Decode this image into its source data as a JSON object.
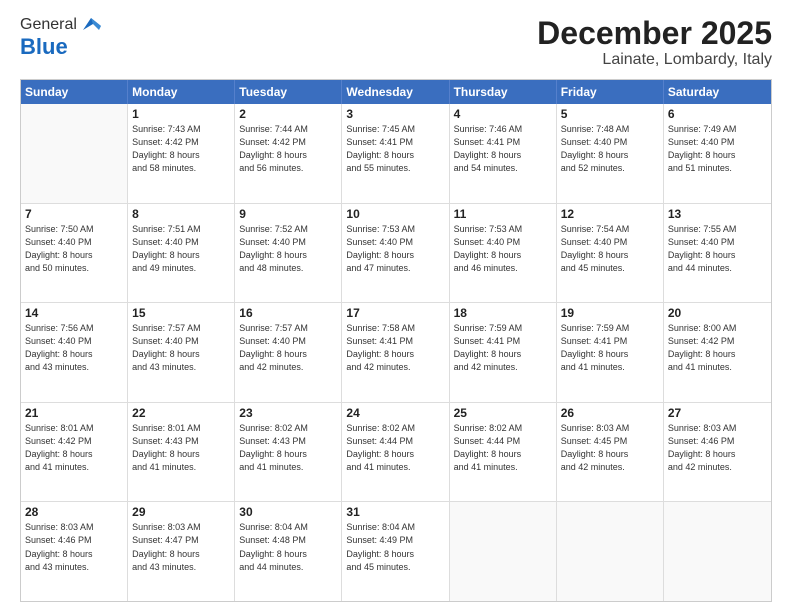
{
  "logo": {
    "general": "General",
    "blue": "Blue"
  },
  "title": "December 2025",
  "subtitle": "Lainate, Lombardy, Italy",
  "days_of_week": [
    "Sunday",
    "Monday",
    "Tuesday",
    "Wednesday",
    "Thursday",
    "Friday",
    "Saturday"
  ],
  "weeks": [
    [
      {
        "day": "",
        "info": ""
      },
      {
        "day": "1",
        "info": "Sunrise: 7:43 AM\nSunset: 4:42 PM\nDaylight: 8 hours\nand 58 minutes."
      },
      {
        "day": "2",
        "info": "Sunrise: 7:44 AM\nSunset: 4:42 PM\nDaylight: 8 hours\nand 56 minutes."
      },
      {
        "day": "3",
        "info": "Sunrise: 7:45 AM\nSunset: 4:41 PM\nDaylight: 8 hours\nand 55 minutes."
      },
      {
        "day": "4",
        "info": "Sunrise: 7:46 AM\nSunset: 4:41 PM\nDaylight: 8 hours\nand 54 minutes."
      },
      {
        "day": "5",
        "info": "Sunrise: 7:48 AM\nSunset: 4:40 PM\nDaylight: 8 hours\nand 52 minutes."
      },
      {
        "day": "6",
        "info": "Sunrise: 7:49 AM\nSunset: 4:40 PM\nDaylight: 8 hours\nand 51 minutes."
      }
    ],
    [
      {
        "day": "7",
        "info": "Sunrise: 7:50 AM\nSunset: 4:40 PM\nDaylight: 8 hours\nand 50 minutes."
      },
      {
        "day": "8",
        "info": "Sunrise: 7:51 AM\nSunset: 4:40 PM\nDaylight: 8 hours\nand 49 minutes."
      },
      {
        "day": "9",
        "info": "Sunrise: 7:52 AM\nSunset: 4:40 PM\nDaylight: 8 hours\nand 48 minutes."
      },
      {
        "day": "10",
        "info": "Sunrise: 7:53 AM\nSunset: 4:40 PM\nDaylight: 8 hours\nand 47 minutes."
      },
      {
        "day": "11",
        "info": "Sunrise: 7:53 AM\nSunset: 4:40 PM\nDaylight: 8 hours\nand 46 minutes."
      },
      {
        "day": "12",
        "info": "Sunrise: 7:54 AM\nSunset: 4:40 PM\nDaylight: 8 hours\nand 45 minutes."
      },
      {
        "day": "13",
        "info": "Sunrise: 7:55 AM\nSunset: 4:40 PM\nDaylight: 8 hours\nand 44 minutes."
      }
    ],
    [
      {
        "day": "14",
        "info": "Sunrise: 7:56 AM\nSunset: 4:40 PM\nDaylight: 8 hours\nand 43 minutes."
      },
      {
        "day": "15",
        "info": "Sunrise: 7:57 AM\nSunset: 4:40 PM\nDaylight: 8 hours\nand 43 minutes."
      },
      {
        "day": "16",
        "info": "Sunrise: 7:57 AM\nSunset: 4:40 PM\nDaylight: 8 hours\nand 42 minutes."
      },
      {
        "day": "17",
        "info": "Sunrise: 7:58 AM\nSunset: 4:41 PM\nDaylight: 8 hours\nand 42 minutes."
      },
      {
        "day": "18",
        "info": "Sunrise: 7:59 AM\nSunset: 4:41 PM\nDaylight: 8 hours\nand 42 minutes."
      },
      {
        "day": "19",
        "info": "Sunrise: 7:59 AM\nSunset: 4:41 PM\nDaylight: 8 hours\nand 41 minutes."
      },
      {
        "day": "20",
        "info": "Sunrise: 8:00 AM\nSunset: 4:42 PM\nDaylight: 8 hours\nand 41 minutes."
      }
    ],
    [
      {
        "day": "21",
        "info": "Sunrise: 8:01 AM\nSunset: 4:42 PM\nDaylight: 8 hours\nand 41 minutes."
      },
      {
        "day": "22",
        "info": "Sunrise: 8:01 AM\nSunset: 4:43 PM\nDaylight: 8 hours\nand 41 minutes."
      },
      {
        "day": "23",
        "info": "Sunrise: 8:02 AM\nSunset: 4:43 PM\nDaylight: 8 hours\nand 41 minutes."
      },
      {
        "day": "24",
        "info": "Sunrise: 8:02 AM\nSunset: 4:44 PM\nDaylight: 8 hours\nand 41 minutes."
      },
      {
        "day": "25",
        "info": "Sunrise: 8:02 AM\nSunset: 4:44 PM\nDaylight: 8 hours\nand 41 minutes."
      },
      {
        "day": "26",
        "info": "Sunrise: 8:03 AM\nSunset: 4:45 PM\nDaylight: 8 hours\nand 42 minutes."
      },
      {
        "day": "27",
        "info": "Sunrise: 8:03 AM\nSunset: 4:46 PM\nDaylight: 8 hours\nand 42 minutes."
      }
    ],
    [
      {
        "day": "28",
        "info": "Sunrise: 8:03 AM\nSunset: 4:46 PM\nDaylight: 8 hours\nand 43 minutes."
      },
      {
        "day": "29",
        "info": "Sunrise: 8:03 AM\nSunset: 4:47 PM\nDaylight: 8 hours\nand 43 minutes."
      },
      {
        "day": "30",
        "info": "Sunrise: 8:04 AM\nSunset: 4:48 PM\nDaylight: 8 hours\nand 44 minutes."
      },
      {
        "day": "31",
        "info": "Sunrise: 8:04 AM\nSunset: 4:49 PM\nDaylight: 8 hours\nand 45 minutes."
      },
      {
        "day": "",
        "info": ""
      },
      {
        "day": "",
        "info": ""
      },
      {
        "day": "",
        "info": ""
      }
    ]
  ]
}
